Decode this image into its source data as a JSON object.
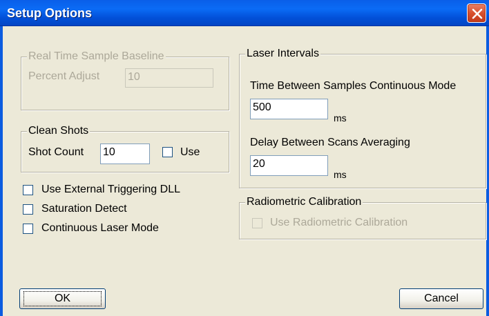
{
  "window": {
    "title": "Setup Options"
  },
  "baseline": {
    "legend": "Real Time Sample Baseline",
    "percent_label": "Percent Adjust",
    "percent_value": "10"
  },
  "clean_shots": {
    "legend": "Clean Shots",
    "count_label": "Shot Count",
    "count_value": "10",
    "use_label": "Use"
  },
  "options": {
    "external_trigger": "Use External Triggering DLL",
    "saturation": "Saturation Detect",
    "continuous": "Continuous Laser Mode"
  },
  "laser": {
    "legend": "Laser Intervals",
    "continuous_label": "Time Between Samples Continuous Mode",
    "continuous_value": "500",
    "continuous_unit": "ms",
    "averaging_label": "Delay Between Scans Averaging",
    "averaging_value": "20",
    "averaging_unit": "ms"
  },
  "radiometric": {
    "legend": "Radiometric Calibration",
    "use_label": "Use Radiometric Calibration"
  },
  "buttons": {
    "ok": "OK",
    "cancel": "Cancel"
  },
  "colors": {
    "titlebar": "#0a5ee8",
    "dialog_bg": "#ece9d8",
    "close": "#d8502e"
  },
  "icons": {
    "close": "close-icon"
  }
}
